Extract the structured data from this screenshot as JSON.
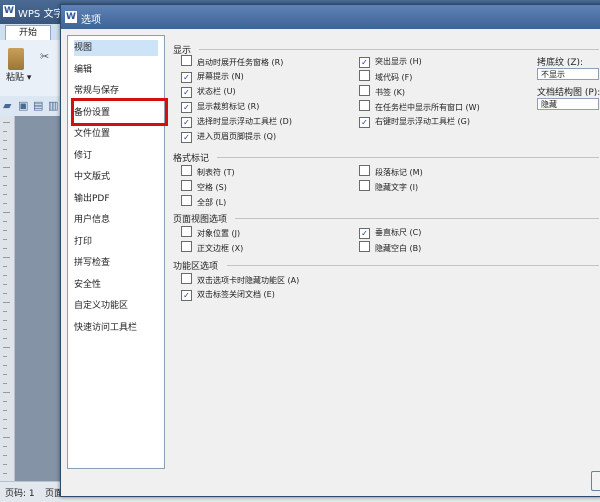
{
  "app": {
    "title": "WPS 文字",
    "logo": "W",
    "tab_label": "开始",
    "paste_label": "粘贴",
    "status_page": "页码: 1",
    "status_section": "页面"
  },
  "dialog": {
    "title": "选项",
    "icon": "W",
    "nav_items": [
      "视图",
      "编辑",
      "常规与保存",
      "备份设置",
      "文件位置",
      "修订",
      "中文版式",
      "输出PDF",
      "用户信息",
      "打印",
      "拼写检查",
      "安全性",
      "自定义功能区",
      "快速访问工具栏"
    ],
    "selected_nav": "视图",
    "highlighted_nav": "备份设置",
    "sections": {
      "display": {
        "title": "显示",
        "left": [
          {
            "label": "启动时展开任务窗格 (R)",
            "checked": false
          },
          {
            "label": "屏幕提示 (N)",
            "checked": true
          },
          {
            "label": "状态栏 (U)",
            "checked": true
          },
          {
            "label": "显示裁剪标记 (R)",
            "checked": true
          },
          {
            "label": "选择时显示浮动工具栏 (D)",
            "checked": true
          },
          {
            "label": "进入页眉页脚提示 (Q)",
            "checked": true
          }
        ],
        "right": [
          {
            "label": "突出显示 (H)",
            "checked": true
          },
          {
            "label": "域代码 (F)",
            "checked": false
          },
          {
            "label": "书签 (K)",
            "checked": false
          },
          {
            "label": "在任务栏中显示所有窗口 (W)",
            "checked": false
          },
          {
            "label": "右键时显示浮动工具栏 (G)",
            "checked": true
          }
        ],
        "texture_label": "拷底纹 (Z):",
        "texture_value": "不显示",
        "docmap_label": "文档结构图 (P):",
        "docmap_value": "隐藏"
      },
      "format_marks": {
        "title": "格式标记",
        "left": [
          {
            "label": "制表符 (T)",
            "checked": false
          },
          {
            "label": "空格 (S)",
            "checked": false
          },
          {
            "label": "全部 (L)",
            "checked": false
          }
        ],
        "right": [
          {
            "label": "段落标记 (M)",
            "checked": false
          },
          {
            "label": "隐藏文字 (I)",
            "checked": false
          }
        ]
      },
      "page_view": {
        "title": "页面视图选项",
        "left": [
          {
            "label": "对象位置 (J)",
            "checked": false
          },
          {
            "label": "正文边框 (X)",
            "checked": false
          }
        ],
        "right": [
          {
            "label": "垂直标尺 (C)",
            "checked": true
          },
          {
            "label": "隐藏空白 (B)",
            "checked": false
          }
        ]
      },
      "ribbon": {
        "title": "功能区选项",
        "items": [
          {
            "label": "双击选项卡时隐藏功能区 (A)",
            "checked": false
          },
          {
            "label": "双击标签关闭文档 (E)",
            "checked": true
          }
        ]
      }
    }
  }
}
